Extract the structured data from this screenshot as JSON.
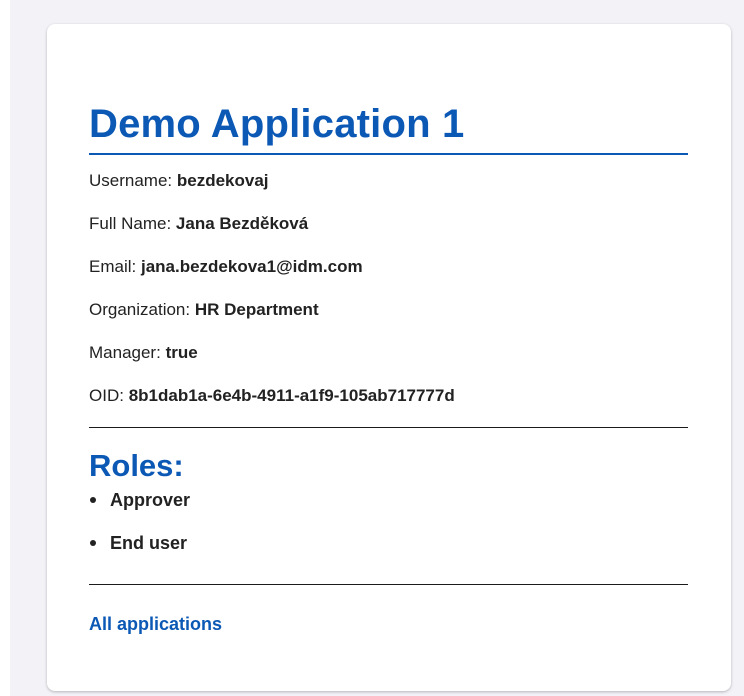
{
  "app": {
    "title": "Demo Application 1"
  },
  "user_info": {
    "rows": [
      {
        "label": "Username:",
        "value": "bezdekovaj"
      },
      {
        "label": "Full Name:",
        "value": "Jana Bezděková"
      },
      {
        "label": "Email:",
        "value": "jana.bezdekova1@idm.com"
      },
      {
        "label": "Organization:",
        "value": "HR Department"
      },
      {
        "label": "Manager:",
        "value": "true"
      },
      {
        "label": "OID:",
        "value": "8b1dab1a-6e4b-4911-a1f9-105ab717777d"
      }
    ]
  },
  "roles": {
    "heading": "Roles:",
    "items": [
      "Approver",
      "End user"
    ]
  },
  "links": {
    "all_applications": "All applications"
  },
  "colors": {
    "accent": "#0b58b5",
    "page_background": "#f2f2f7",
    "card_background": "#ffffff",
    "text": "#222222"
  }
}
